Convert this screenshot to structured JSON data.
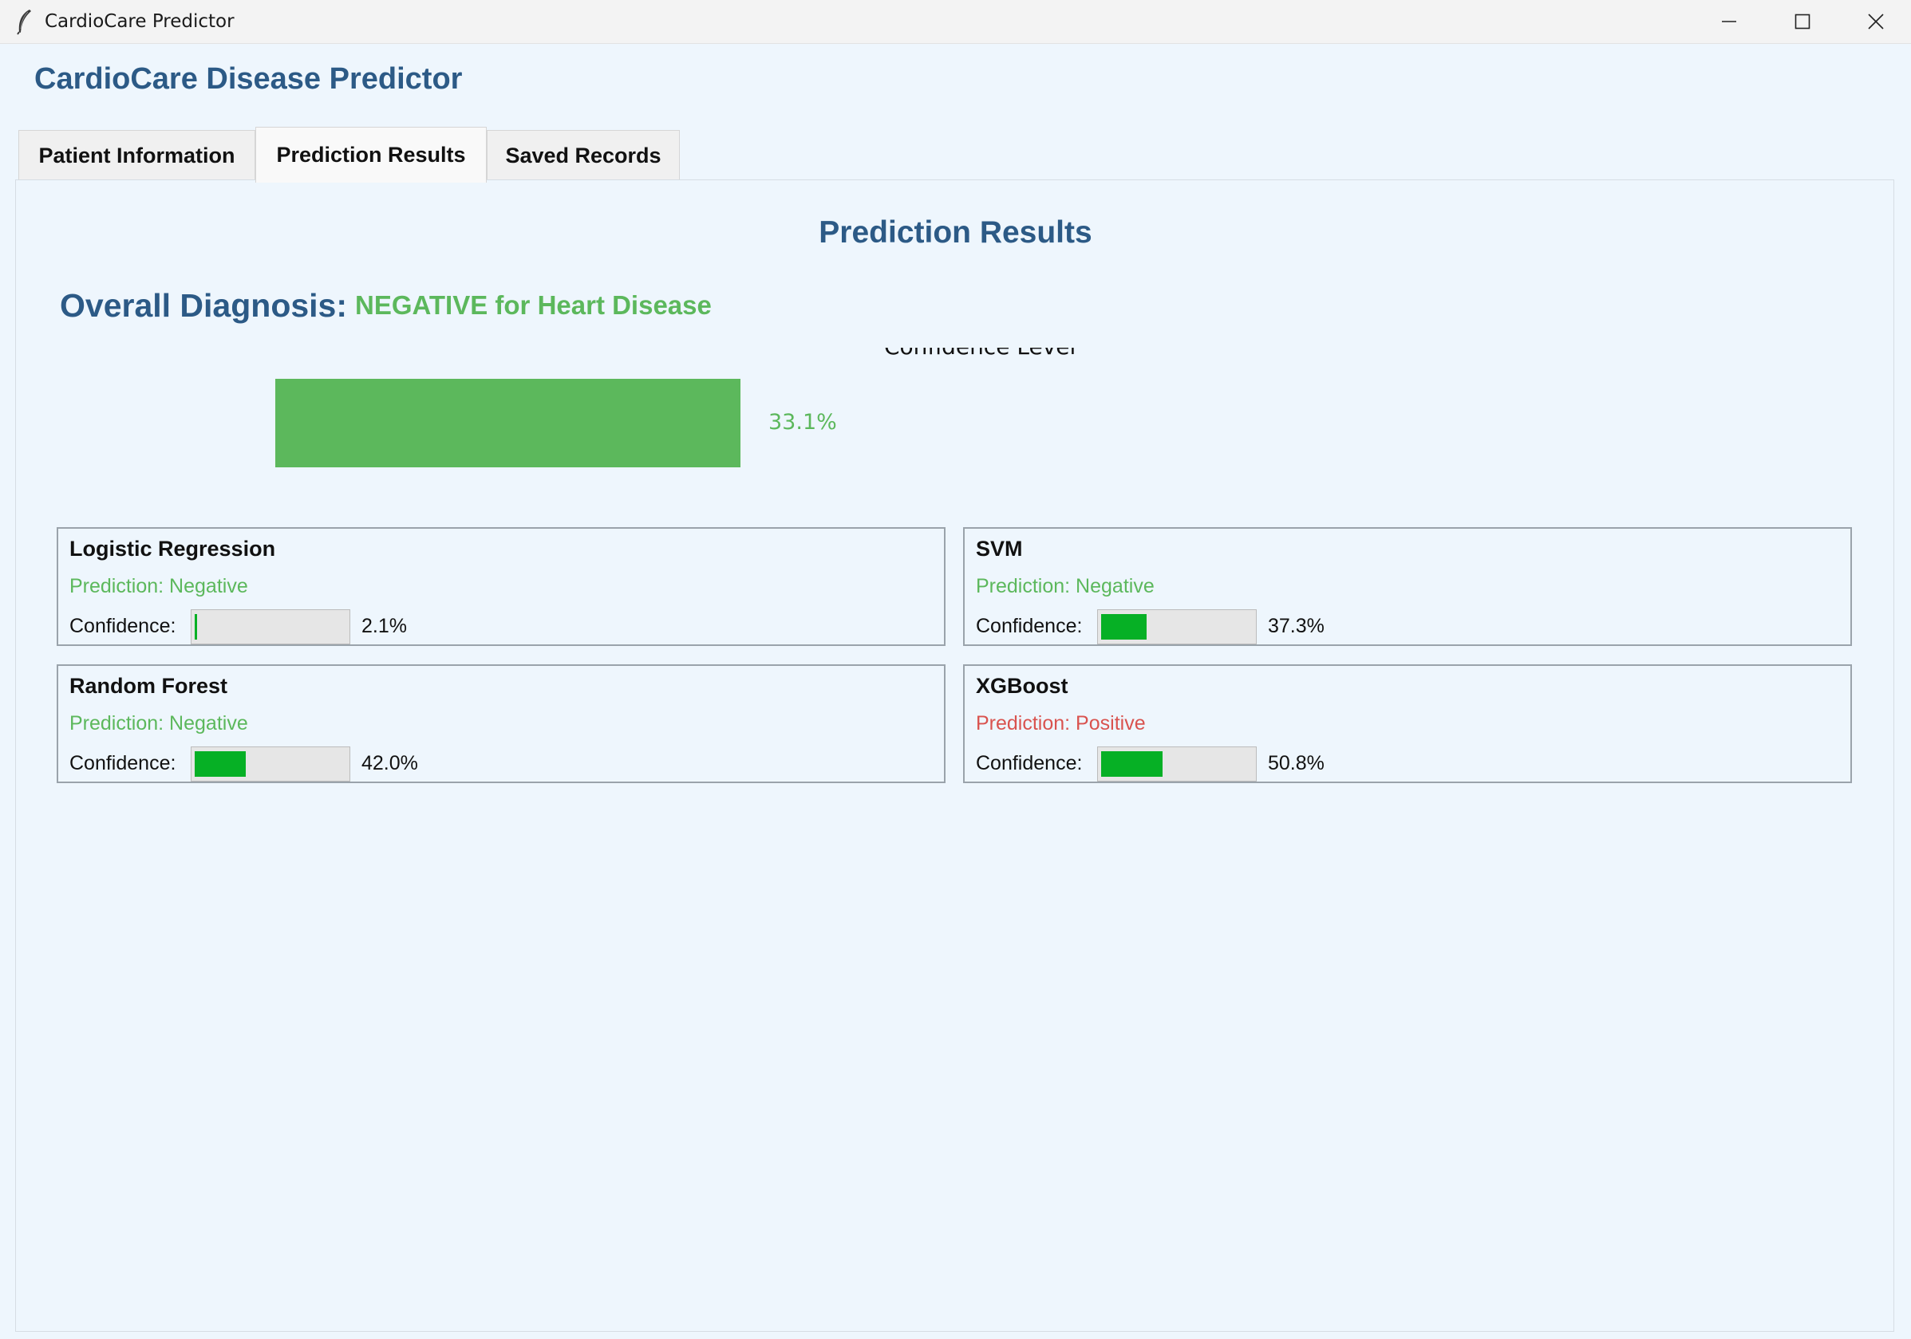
{
  "window": {
    "title": "CardioCare Predictor"
  },
  "app": {
    "heading": "CardioCare Disease Predictor"
  },
  "tabs": [
    {
      "label": "Patient Information",
      "active": false
    },
    {
      "label": "Prediction Results",
      "active": true
    },
    {
      "label": "Saved Records",
      "active": false
    }
  ],
  "results": {
    "heading": "Prediction Results",
    "overall_label": "Overall Diagnosis:",
    "overall_value": "NEGATIVE for Heart Disease",
    "confidence_level_label": "Confidence Level",
    "overall_confidence_pct": "33.1%",
    "overall_confidence_value": 33.1
  },
  "models": [
    {
      "name": "Logistic Regression",
      "prediction": "Prediction: Negative",
      "status": "negative",
      "confidence_label": "Confidence:",
      "confidence_pct": "2.1%",
      "confidence_value": 2.1
    },
    {
      "name": "SVM",
      "prediction": "Prediction: Negative",
      "status": "negative",
      "confidence_label": "Confidence:",
      "confidence_pct": "37.3%",
      "confidence_value": 37.3
    },
    {
      "name": "Random Forest",
      "prediction": "Prediction: Negative",
      "status": "negative",
      "confidence_label": "Confidence:",
      "confidence_pct": "42.0%",
      "confidence_value": 42.0
    },
    {
      "name": "XGBoost",
      "prediction": "Prediction: Positive",
      "status": "positive",
      "confidence_label": "Confidence:",
      "confidence_pct": "50.8%",
      "confidence_value": 50.8
    }
  ],
  "colors": {
    "heading_blue": "#2c5a86",
    "negative_green": "#5cb85c",
    "positive_red": "#d9534f",
    "progress_green": "#06b025",
    "background": "#eef6fd"
  },
  "icons": {
    "app": "feather-icon",
    "minimize": "minimize-icon",
    "maximize": "maximize-icon",
    "close": "close-icon"
  }
}
